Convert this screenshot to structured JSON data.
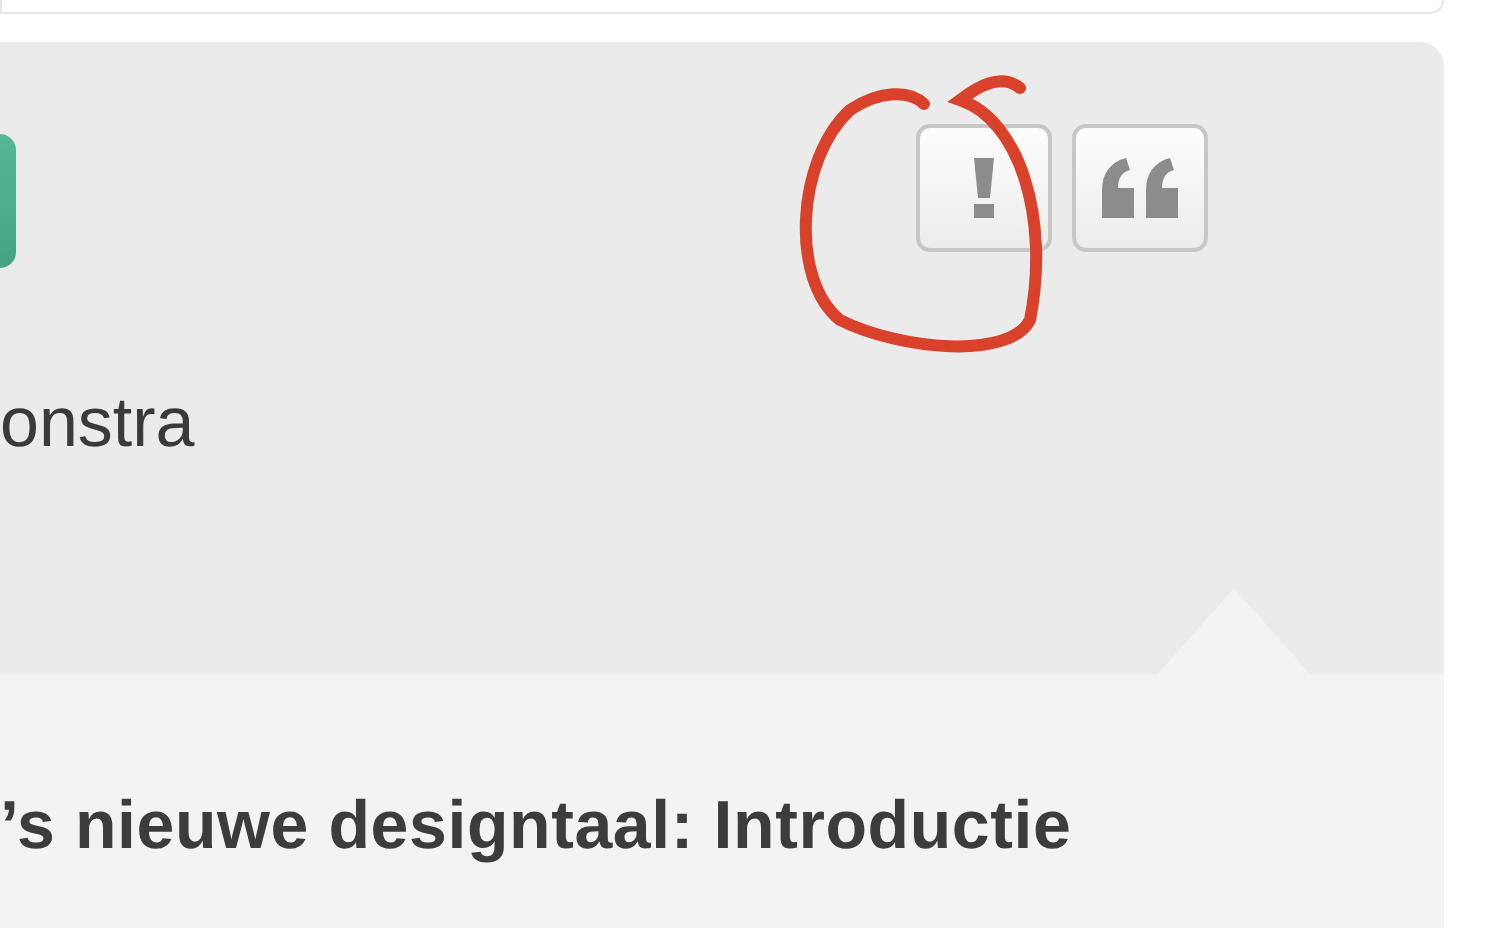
{
  "author": {
    "name": "onstra"
  },
  "actions": [
    {
      "kind": "report"
    },
    {
      "kind": "quote"
    }
  ],
  "post": {
    "title": "’s nieuwe designtaal: Introductie"
  }
}
